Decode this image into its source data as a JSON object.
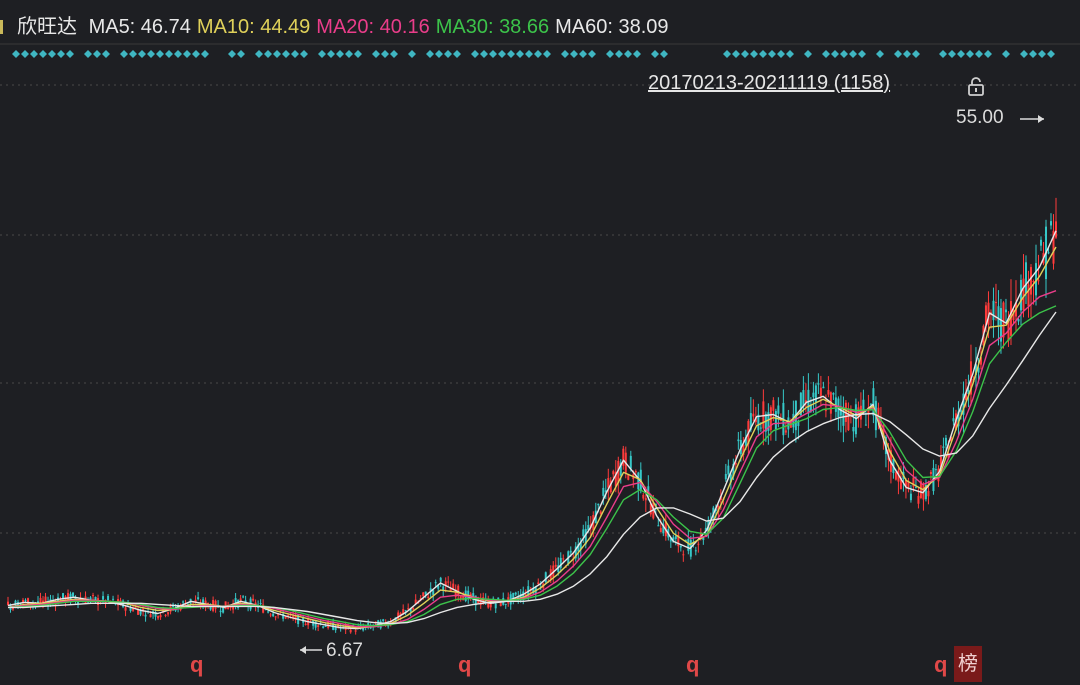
{
  "stock_name": "欣旺达",
  "legend": [
    {
      "label": "MA5:",
      "value": "46.74",
      "color": "#e8e8e8"
    },
    {
      "label": "MA10:",
      "value": "44.49",
      "color": "#e0d15a"
    },
    {
      "label": "MA20:",
      "value": "40.16",
      "color": "#ea3d8a"
    },
    {
      "label": "MA30:",
      "value": "38.66",
      "color": "#3cc34a"
    },
    {
      "label": "MA60:",
      "value": "38.09",
      "color": "#e8e8e8"
    }
  ],
  "range_label": "20170213-20211119 (1158)",
  "max_label": "55.00",
  "min_label": "6.67",
  "marker_q": "q",
  "marker_bang": "榜",
  "colors": {
    "background": "#1e1f23",
    "up": "#ff3b3b",
    "down": "#36c8c8",
    "grid": "#4a4a4a",
    "marker": "#3fb6c2"
  },
  "chart_data": {
    "type": "line",
    "x_range": [
      "20170213",
      "20211119"
    ],
    "count": 1158,
    "ylim": [
      5,
      58
    ],
    "grid": "horizontal-dotted",
    "series": [
      {
        "name": "MA5",
        "color": "#e8e8e8",
        "values": [
          9.2,
          9.5,
          9.4,
          9.8,
          10.0,
          9.7,
          9.6,
          9.2,
          8.7,
          8.4,
          8.9,
          9.6,
          9.3,
          9.0,
          9.6,
          9.2,
          8.5,
          8.0,
          7.6,
          7.3,
          7.0,
          6.9,
          7.2,
          7.6,
          8.6,
          10.0,
          11.4,
          10.6,
          9.8,
          9.4,
          9.6,
          10.3,
          11.3,
          12.8,
          14.4,
          16.8,
          20.4,
          23.5,
          21.5,
          18.0,
          15.5,
          14.8,
          16.6,
          20.5,
          24.5,
          27.8,
          28.0,
          27.2,
          29.2,
          29.8,
          28.5,
          27.6,
          29.0,
          23.5,
          20.8,
          20.3,
          22.4,
          27.5,
          32.0,
          38.0,
          37.0,
          40.4,
          42.5,
          46.1
        ]
      },
      {
        "name": "MA10",
        "color": "#e0d15a",
        "values": [
          9.0,
          9.3,
          9.4,
          9.6,
          9.8,
          9.7,
          9.6,
          9.4,
          9.0,
          8.7,
          8.8,
          9.3,
          9.3,
          9.1,
          9.4,
          9.2,
          8.7,
          8.3,
          7.9,
          7.5,
          7.2,
          7.0,
          7.1,
          7.4,
          8.2,
          9.4,
          10.7,
          10.5,
          10.0,
          9.6,
          9.6,
          10.0,
          10.9,
          12.2,
          13.8,
          15.9,
          19.2,
          22.3,
          21.6,
          18.8,
          16.3,
          15.2,
          16.1,
          19.6,
          23.5,
          26.9,
          27.7,
          27.3,
          28.7,
          29.5,
          28.7,
          27.9,
          28.8,
          24.4,
          21.5,
          20.6,
          22.0,
          26.6,
          31.0,
          36.6,
          36.8,
          39.5,
          41.6,
          44.5
        ]
      },
      {
        "name": "MA20",
        "color": "#ea3d8a",
        "values": [
          9.0,
          9.2,
          9.3,
          9.5,
          9.7,
          9.7,
          9.6,
          9.5,
          9.2,
          8.9,
          8.8,
          9.1,
          9.2,
          9.1,
          9.3,
          9.2,
          8.9,
          8.5,
          8.1,
          7.7,
          7.4,
          7.1,
          7.1,
          7.3,
          7.8,
          8.8,
          10.0,
          10.2,
          10.0,
          9.7,
          9.6,
          9.9,
          10.5,
          11.6,
          13.1,
          15.0,
          17.9,
          20.9,
          21.3,
          19.4,
          17.2,
          15.8,
          16.0,
          18.6,
          22.3,
          25.8,
          27.1,
          27.2,
          28.1,
          29.0,
          28.8,
          28.2,
          28.6,
          25.5,
          22.5,
          21.1,
          21.8,
          25.3,
          29.5,
          34.8,
          36.0,
          38.1,
          39.6,
          40.2
        ]
      },
      {
        "name": "MA30",
        "color": "#3cc34a",
        "values": [
          9.0,
          9.1,
          9.2,
          9.4,
          9.6,
          9.6,
          9.6,
          9.5,
          9.3,
          9.0,
          8.9,
          9.0,
          9.1,
          9.1,
          9.2,
          9.2,
          9.0,
          8.7,
          8.3,
          7.9,
          7.6,
          7.3,
          7.2,
          7.3,
          7.6,
          8.3,
          9.3,
          9.8,
          9.9,
          9.8,
          9.7,
          9.8,
          10.2,
          11.1,
          12.4,
          14.2,
          16.8,
          19.6,
          20.6,
          19.6,
          17.9,
          16.5,
          16.2,
          17.8,
          21.2,
          24.7,
          26.4,
          27.0,
          27.6,
          28.5,
          28.7,
          28.4,
          28.5,
          26.3,
          23.5,
          21.8,
          21.9,
          24.4,
          28.3,
          33.0,
          35.1,
          36.9,
          38.0,
          38.7
        ]
      },
      {
        "name": "MA60",
        "color": "#e8e8e8",
        "values": [
          9.0,
          9.0,
          9.1,
          9.2,
          9.3,
          9.4,
          9.4,
          9.4,
          9.4,
          9.3,
          9.2,
          9.1,
          9.1,
          9.1,
          9.1,
          9.1,
          9.0,
          8.8,
          8.6,
          8.3,
          8.0,
          7.7,
          7.5,
          7.4,
          7.5,
          7.9,
          8.5,
          9.0,
          9.3,
          9.5,
          9.6,
          9.6,
          9.8,
          10.3,
          11.1,
          12.3,
          14.0,
          16.2,
          17.9,
          18.8,
          18.8,
          18.2,
          17.5,
          17.8,
          19.4,
          21.8,
          23.8,
          25.2,
          26.3,
          27.1,
          27.7,
          28.0,
          28.1,
          27.3,
          26.0,
          24.6,
          23.9,
          24.2,
          25.9,
          28.6,
          30.9,
          33.3,
          35.8,
          38.1
        ]
      }
    ]
  }
}
